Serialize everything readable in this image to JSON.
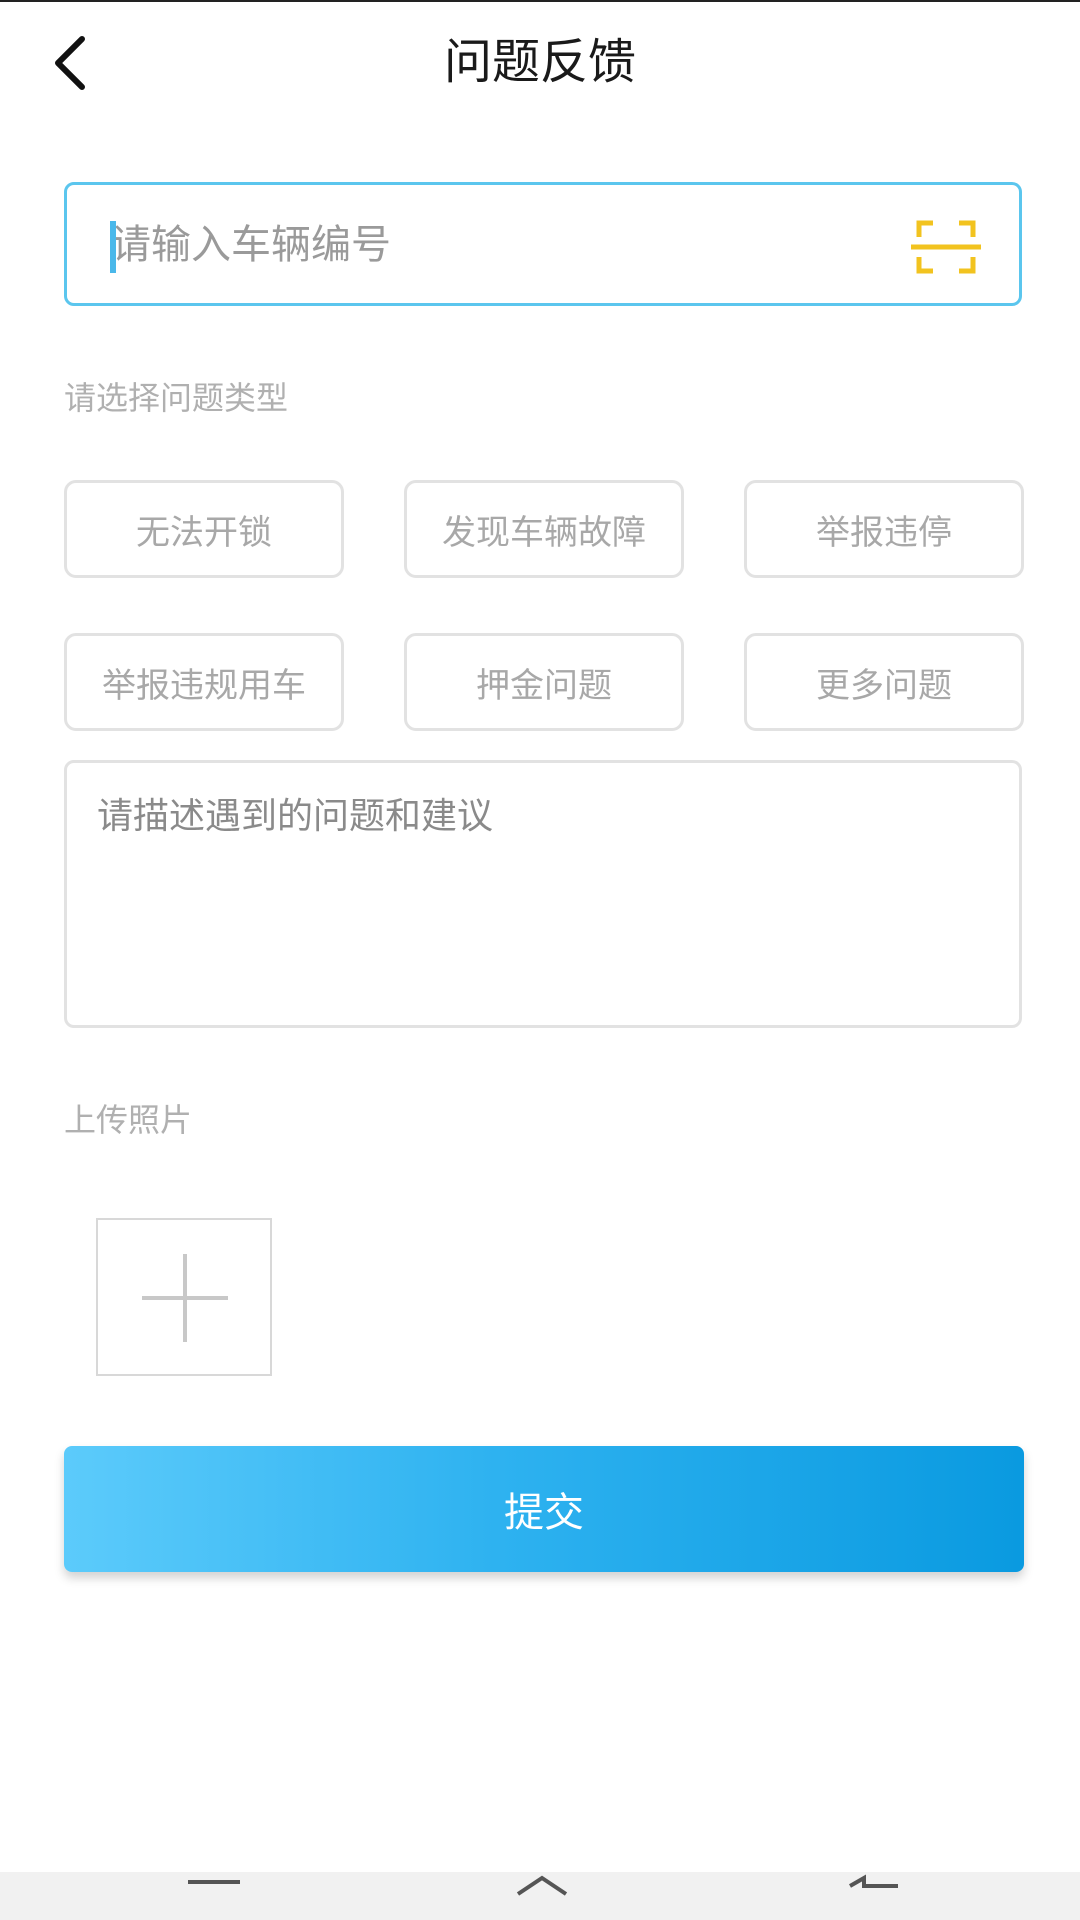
{
  "header": {
    "title": "问题反馈"
  },
  "vehicle": {
    "placeholder": "请输入车辆编号",
    "value": ""
  },
  "problem_type": {
    "label": "请选择问题类型",
    "options": [
      "无法开锁",
      "发现车辆故障",
      "举报违停",
      "举报违规用车",
      "押金问题",
      "更多问题"
    ]
  },
  "description": {
    "placeholder": "请描述遇到的问题和建议",
    "value": ""
  },
  "upload": {
    "label": "上传照片"
  },
  "submit": {
    "label": "提交"
  },
  "colors": {
    "accent": "#5bc6ee",
    "scan_icon": "#f2c31f",
    "submit_start": "#5ccbfb",
    "submit_end": "#0a9ae0"
  },
  "icons": {
    "back": "chevron-left-icon",
    "scan": "scan-frame-icon",
    "upload": "plus-icon",
    "nav_menu": "menu-icon",
    "nav_home": "home-icon",
    "nav_back": "back-arrow-icon"
  }
}
